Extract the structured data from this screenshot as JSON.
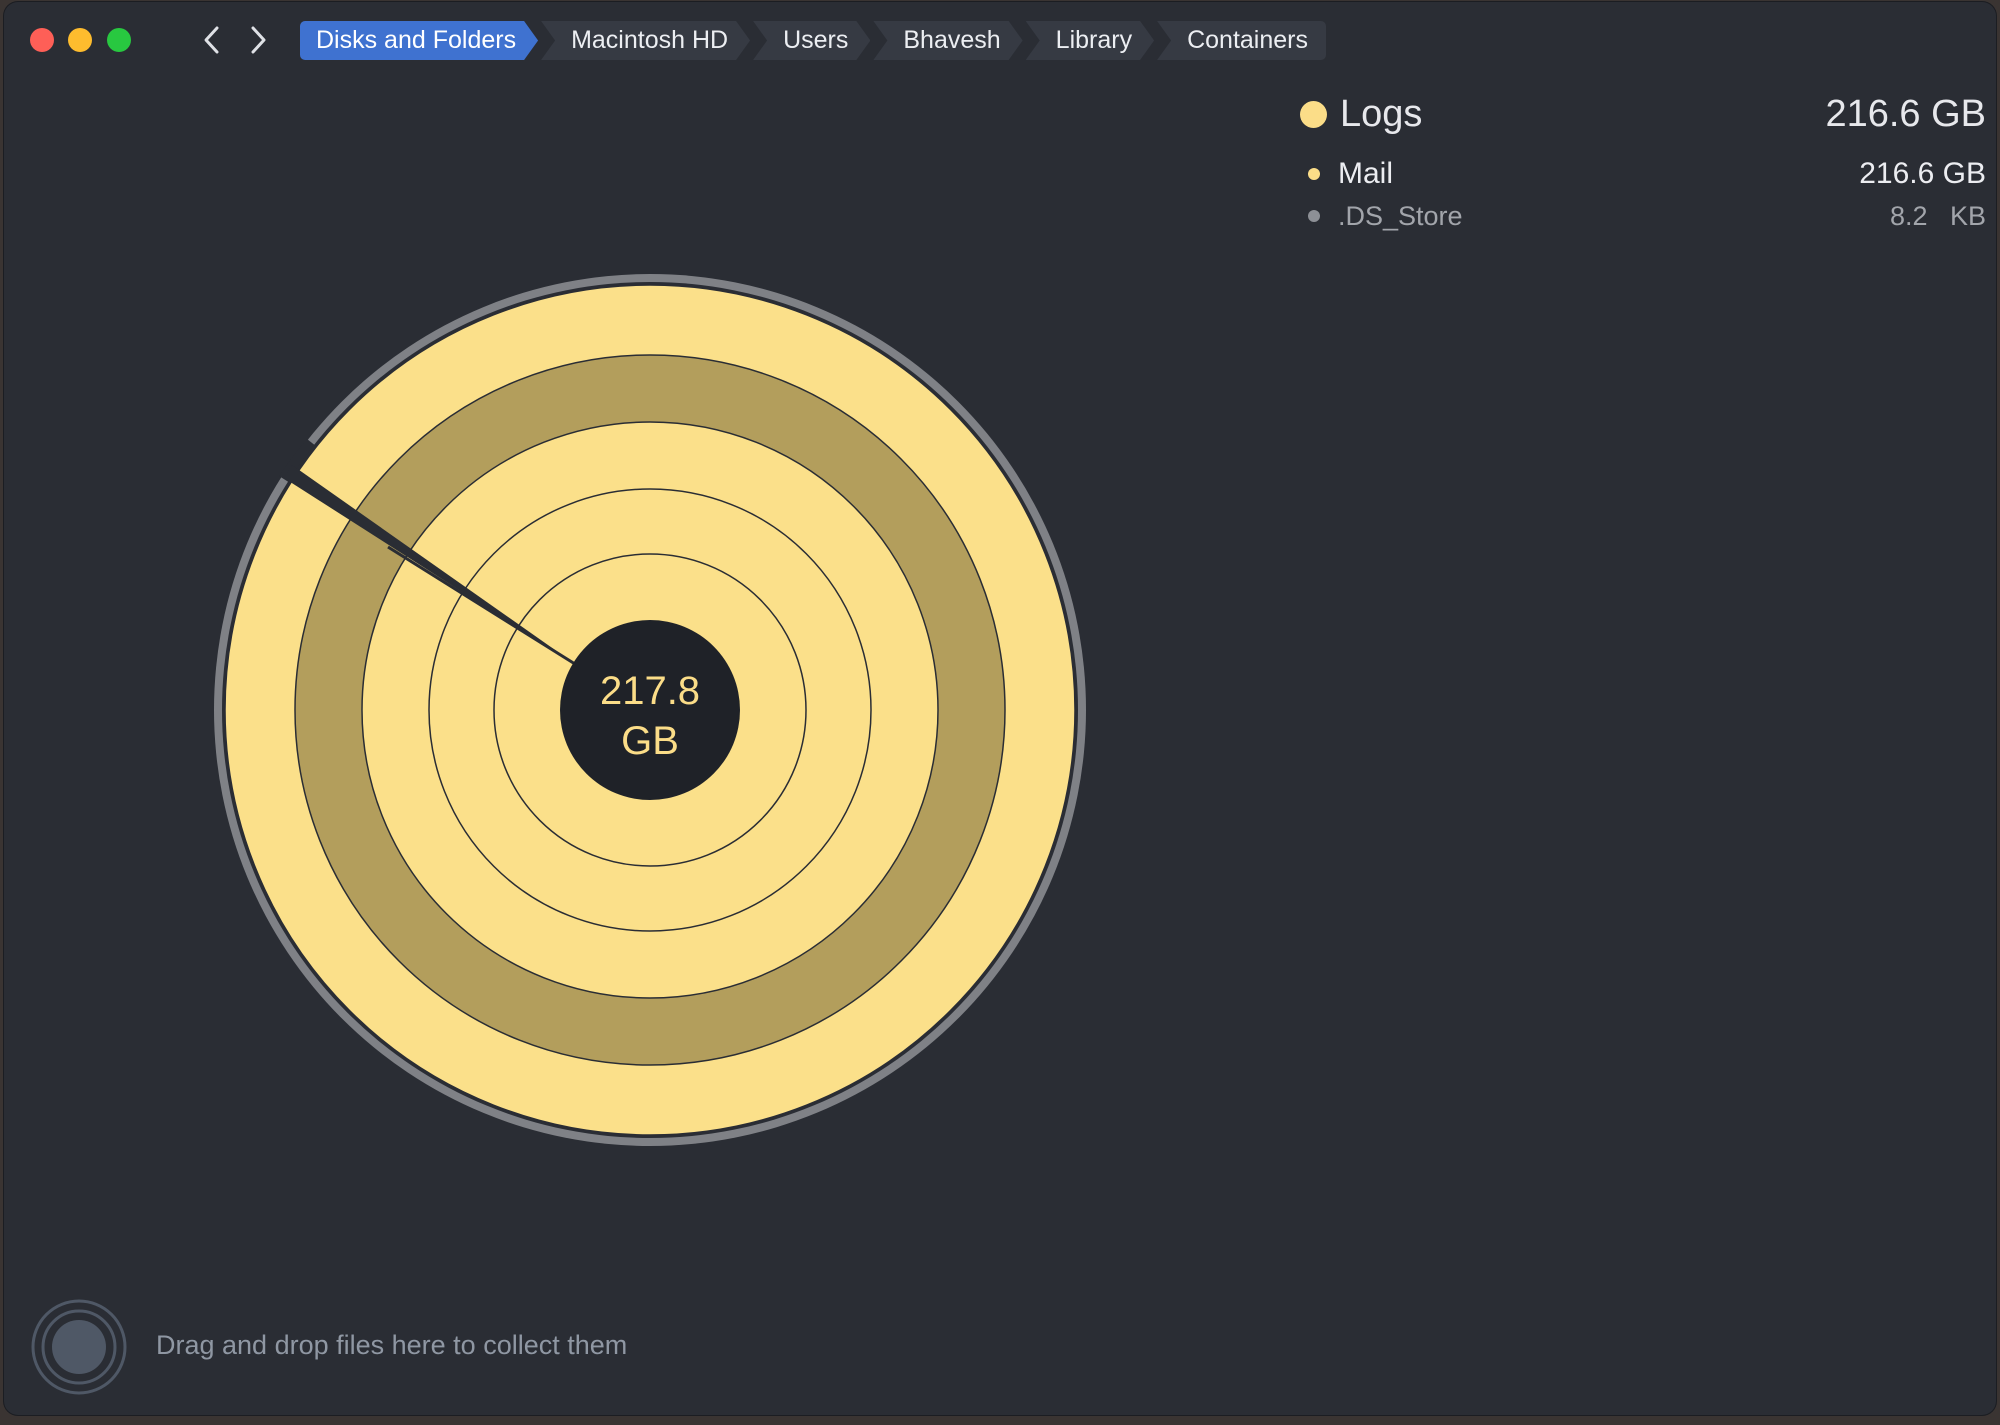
{
  "window": {
    "controls": [
      "close",
      "minimize",
      "zoom"
    ],
    "colors": {
      "close": "#fe5f57",
      "minimize": "#febc2e",
      "zoom": "#28c840",
      "background": "#2a2d34"
    }
  },
  "nav": {
    "back_icon": "chevron-left-icon",
    "forward_icon": "chevron-right-icon"
  },
  "breadcrumb": [
    {
      "label": "Disks and Folders",
      "active": true
    },
    {
      "label": "Macintosh HD",
      "active": false
    },
    {
      "label": "Users",
      "active": false
    },
    {
      "label": "Bhavesh",
      "active": false
    },
    {
      "label": "Library",
      "active": false
    },
    {
      "label": "Containers",
      "active": false
    }
  ],
  "chart_data": {
    "type": "sunburst",
    "center_label_value": "217.8",
    "center_label_unit": "GB",
    "colors": {
      "primary": "#fbe08a",
      "selected_ring": "#b39e5c",
      "other": "#7f8186",
      "hole": "#1f2228"
    }
  },
  "info": {
    "selected": {
      "name": "Logs",
      "size": "216.6 GB",
      "color": "#fbdd88"
    },
    "children": [
      {
        "name": "Mail",
        "size": "216.6 GB",
        "color": "#fbdd88"
      },
      {
        "name": ".DS_Store",
        "size": "8.2   KB",
        "color": "#8d9096"
      }
    ]
  },
  "collector": {
    "icon": "collector-icon",
    "text": "Drag and drop files here to collect them"
  }
}
